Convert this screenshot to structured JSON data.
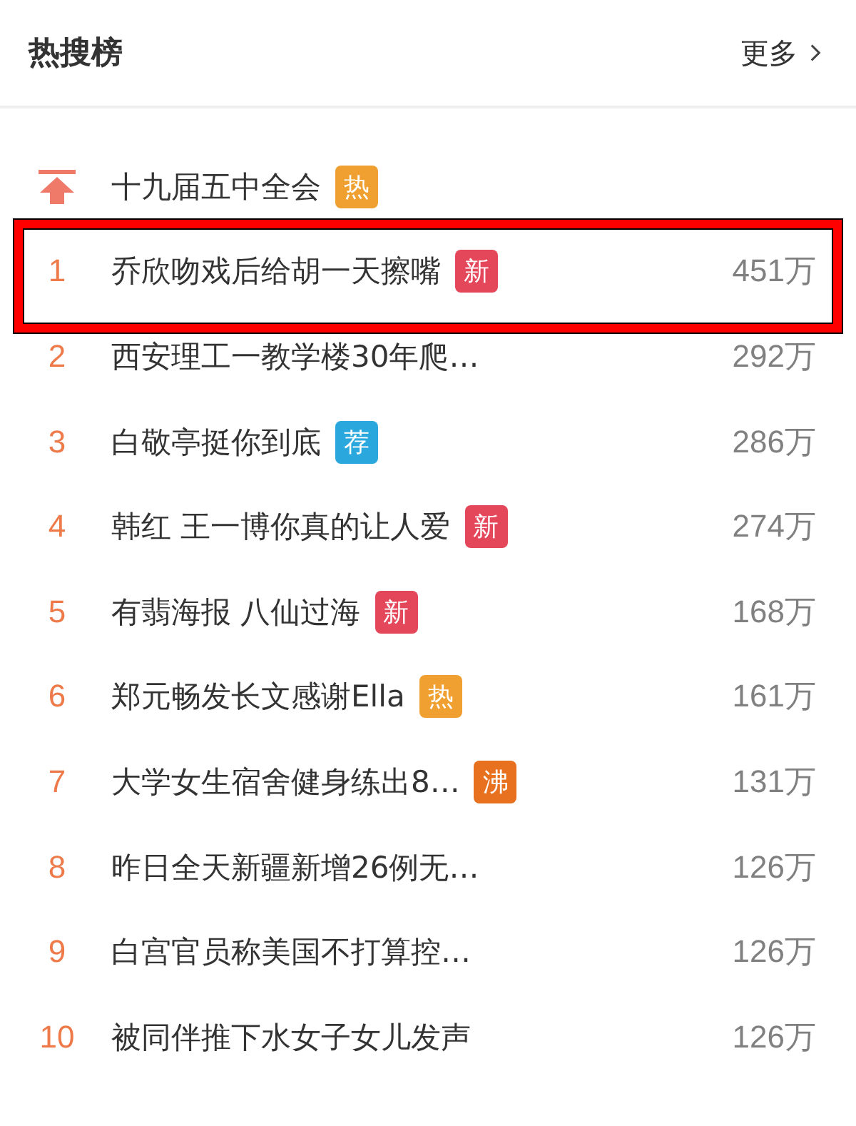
{
  "header": {
    "title": "热搜榜",
    "more_link": "更多"
  },
  "items": [
    {
      "kind": "pinned",
      "title": "十九届五中全会",
      "badge": {
        "text": "热",
        "color": "#f0a030"
      },
      "highlighted": false
    },
    {
      "kind": "ranked",
      "rank": "1",
      "title": "乔欣吻戏后给胡一天擦嘴",
      "badge": {
        "text": "新",
        "color": "#e5475a"
      },
      "count": "451万",
      "highlighted": true
    },
    {
      "kind": "ranked",
      "rank": "2",
      "title": "西安理工一教学楼30年爬…",
      "count": "292万",
      "highlighted": false
    },
    {
      "kind": "ranked",
      "rank": "3",
      "title": "白敬亭挺你到底",
      "badge": {
        "text": "荐",
        "color": "#2aa7dd"
      },
      "count": "286万",
      "highlighted": false
    },
    {
      "kind": "ranked",
      "rank": "4",
      "title": "韩红 王一博你真的让人爱",
      "badge": {
        "text": "新",
        "color": "#e5475a"
      },
      "count": "274万",
      "highlighted": false
    },
    {
      "kind": "ranked",
      "rank": "5",
      "title": "有翡海报 八仙过海",
      "badge": {
        "text": "新",
        "color": "#e5475a"
      },
      "count": "168万",
      "highlighted": false
    },
    {
      "kind": "ranked",
      "rank": "6",
      "title": "郑元畅发长文感谢Ella",
      "badge": {
        "text": "热",
        "color": "#f0a030"
      },
      "count": "161万",
      "highlighted": false
    },
    {
      "kind": "ranked",
      "rank": "7",
      "title": "大学女生宿舍健身练出8…",
      "badge": {
        "text": "沸",
        "color": "#e8711f"
      },
      "count": "131万",
      "highlighted": false
    },
    {
      "kind": "ranked",
      "rank": "8",
      "title": "昨日全天新疆新增26例无…",
      "count": "126万",
      "highlighted": false
    },
    {
      "kind": "ranked",
      "rank": "9",
      "title": "白宫官员称美国不打算控…",
      "count": "126万",
      "highlighted": false
    },
    {
      "kind": "ranked",
      "rank": "10",
      "title": "被同伴推下水女子女儿发声",
      "count": "126万",
      "highlighted": false
    }
  ]
}
